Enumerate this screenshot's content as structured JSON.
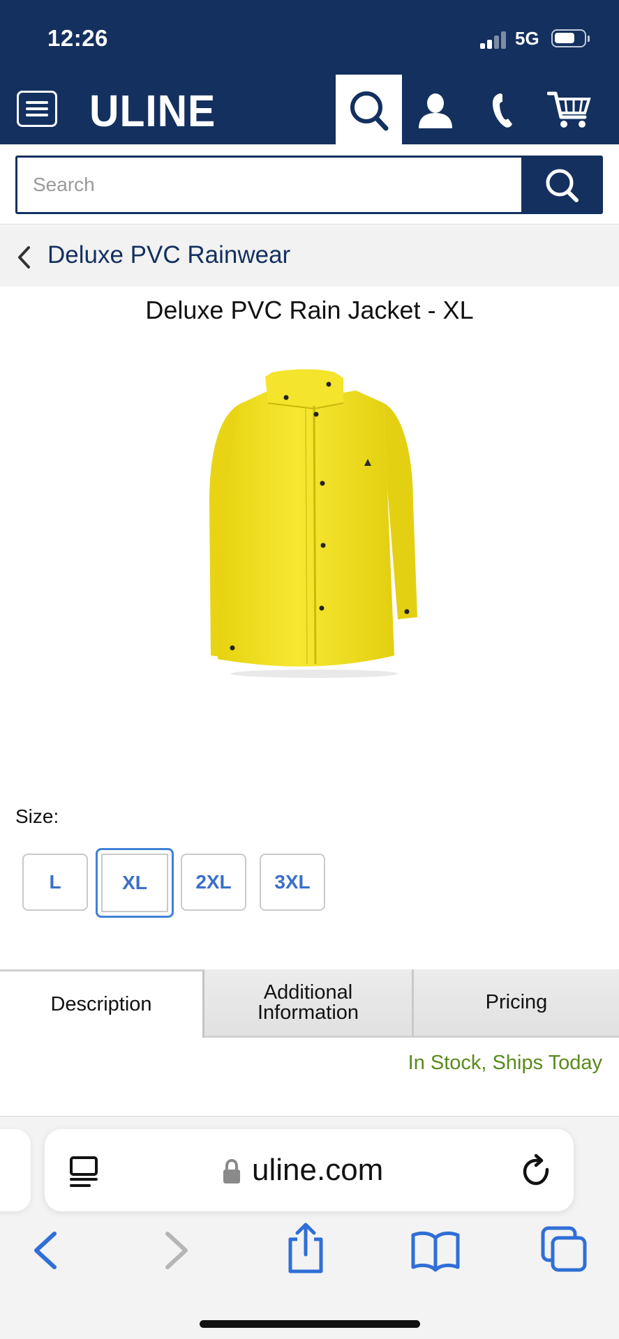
{
  "status_bar": {
    "time": "12:26",
    "network": "5G"
  },
  "header": {
    "logo": "ULINE"
  },
  "search": {
    "placeholder": "Search"
  },
  "breadcrumb": {
    "label": "Deluxe PVC Rainwear"
  },
  "product": {
    "title": "Deluxe PVC Rain Jacket - XL",
    "image_icon": "yellow-rain-jacket",
    "size_label": "Size:",
    "sizes": [
      "L",
      "XL",
      "2XL",
      "3XL"
    ],
    "selected_size": "XL"
  },
  "tabs": [
    {
      "label": "Description",
      "active": true
    },
    {
      "label_line1": "Additional",
      "label_line2": "Information",
      "active": false
    },
    {
      "label": "Pricing",
      "active": false
    }
  ],
  "availability": "In Stock, Ships Today",
  "browser": {
    "url": "uline.com"
  },
  "colors": {
    "brand_navy": "#13305f",
    "link_blue": "#3a6fcc",
    "stock_green": "#5a8a1c",
    "jacket_yellow": "#f2e21c"
  }
}
